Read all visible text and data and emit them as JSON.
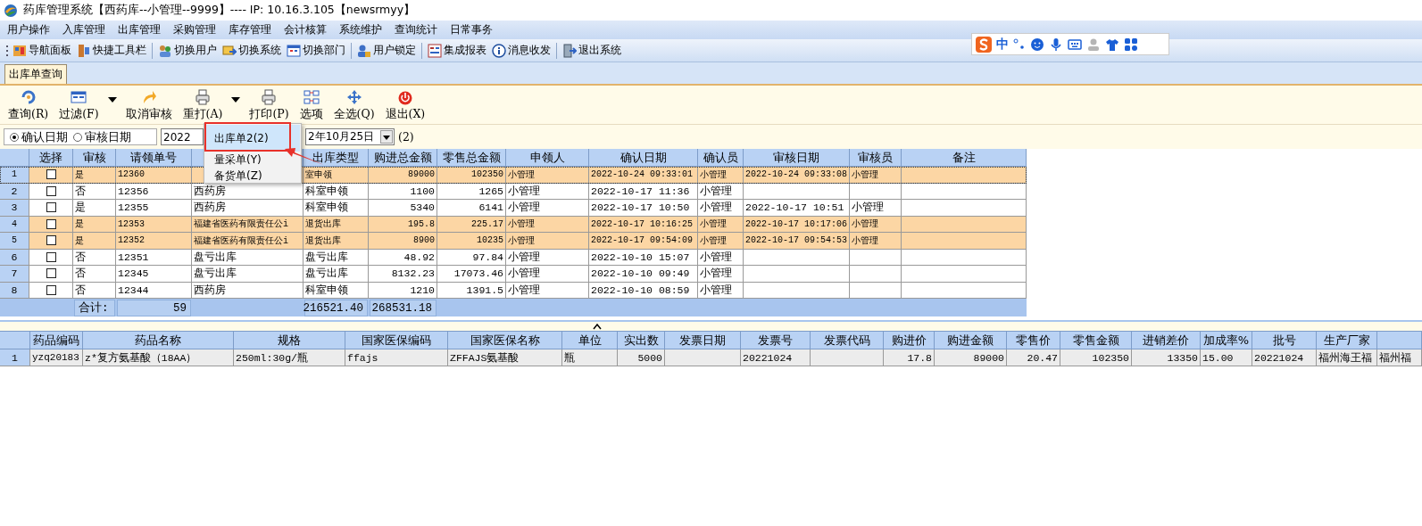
{
  "window": {
    "title": "药库管理系统【西药库--小管理--9999】---- IP: 10.16.3.105【newsrmyy】"
  },
  "menu_bar": [
    "用户操作",
    "入库管理",
    "出库管理",
    "采购管理",
    "库存管理",
    "会计核算",
    "系统维护",
    "查询统计",
    "日常事务"
  ],
  "toolbar": [
    "导航面板",
    "快捷工具栏",
    "切换用户",
    "切换系统",
    "切换部门",
    "用户锁定",
    "集成报表",
    "消息收发",
    "退出系统"
  ],
  "ime_bar": {
    "mode": "中"
  },
  "tabs": [
    {
      "label": "出库单查询",
      "selected": true
    }
  ],
  "actions": [
    "查询(R)",
    "过滤(F)",
    "取消审核",
    "重打(A)",
    "打印(P)",
    "选项",
    "全选(Q)",
    "退出(X)"
  ],
  "filter": {
    "date_modes": [
      {
        "label": "确认日期",
        "selected": true
      },
      {
        "label": "审核日期",
        "selected": false
      }
    ],
    "date_from": "2022",
    "date_to": "2年10月25日",
    "suffix": "(2)"
  },
  "print_menu": {
    "items": [
      {
        "label": "出库单2(2)",
        "selected": true
      },
      {
        "label": "量采单(Y)",
        "selected": false
      },
      {
        "label": "备货单(Z)",
        "selected": false
      }
    ]
  },
  "orders": {
    "select_header": "选择",
    "columns": [
      "审核",
      "请领单号",
      null,
      "出库类型",
      "购进总金额",
      "零售总金额",
      "申领人",
      "确认日期",
      "确认员",
      "审核日期",
      "审核员",
      "备注"
    ],
    "rows": [
      {
        "num": "1",
        "checked": false,
        "selected": true,
        "highlighted": true,
        "cells": [
          "是",
          "12360",
          null,
          "室申领",
          "89000",
          "102350",
          "小管理",
          "2022-10-24 09:33:01",
          "小管理",
          "2022-10-24 09:33:08",
          "小管理",
          null
        ]
      },
      {
        "num": "2",
        "checked": false,
        "selected": false,
        "highlighted": false,
        "cells": [
          "否",
          "12356",
          "西药房",
          "科室申领",
          "1100",
          "1265",
          "小管理",
          "2022-10-17 11:36",
          "小管理",
          null,
          null,
          null
        ]
      },
      {
        "num": "3",
        "checked": false,
        "selected": false,
        "highlighted": false,
        "cells": [
          "是",
          "12355",
          "西药房",
          "科室申领",
          "5340",
          "6141",
          "小管理",
          "2022-10-17 10:50",
          "小管理",
          "2022-10-17 10:51",
          "小管理",
          null
        ]
      },
      {
        "num": "4",
        "checked": false,
        "selected": false,
        "highlighted": true,
        "cells": [
          "是",
          "12353",
          "福建省医药有限责任公i",
          "退货出库",
          "195.8",
          "225.17",
          "小管理",
          "2022-10-17 10:16:25",
          "小管理",
          "2022-10-17 10:17:06",
          "小管理",
          null
        ]
      },
      {
        "num": "5",
        "checked": false,
        "selected": false,
        "highlighted": true,
        "cells": [
          "是",
          "12352",
          "福建省医药有限责任公i",
          "退货出库",
          "8900",
          "10235",
          "小管理",
          "2022-10-17 09:54:09",
          "小管理",
          "2022-10-17 09:54:53",
          "小管理",
          null
        ]
      },
      {
        "num": "6",
        "checked": false,
        "selected": false,
        "highlighted": false,
        "cells": [
          "否",
          "12351",
          "盘亏出库",
          "盘亏出库",
          "48.92",
          "97.84",
          "小管理",
          "2022-10-10 15:07",
          "小管理",
          null,
          null,
          null
        ]
      },
      {
        "num": "7",
        "checked": false,
        "selected": false,
        "highlighted": false,
        "cells": [
          "否",
          "12345",
          "盘亏出库",
          "盘亏出库",
          "8132.23",
          "17073.46",
          "小管理",
          "2022-10-10 09:49",
          "小管理",
          null,
          null,
          null
        ]
      },
      {
        "num": "8",
        "checked": false,
        "selected": false,
        "highlighted": false,
        "cells": [
          "否",
          "12344",
          "西药房",
          "科室申领",
          "1210",
          "1391.5",
          "小管理",
          "2022-10-10 08:59",
          "小管理",
          null,
          null,
          null
        ]
      }
    ],
    "totals": {
      "label": "合计:",
      "count": "59",
      "purchase": "216521.40",
      "retail": "268531.18"
    }
  },
  "details": {
    "columns": [
      "药品编码",
      "药品名称",
      "规格",
      "国家医保编码",
      "国家医保名称",
      "单位",
      "实出数",
      "发票日期",
      "发票号",
      "发票代码",
      "购进价",
      "购进金额",
      "零售价",
      "零售金额",
      "进销差价",
      "加成率%",
      "批号",
      "生产厂家",
      null
    ],
    "rows": [
      {
        "num": "1",
        "selected": true,
        "cells": [
          "yzq20183",
          "z*复方氨基酸（18AA）",
          "250ml:30g/瓶",
          "ffajs",
          "ZFFAJS氨基酸",
          "瓶",
          "5000",
          null,
          "20221024",
          null,
          "17.8",
          "89000",
          "20.47",
          "102350",
          "13350",
          "15.00",
          "20221024",
          "福州海王福",
          "福州福"
        ]
      }
    ]
  }
}
